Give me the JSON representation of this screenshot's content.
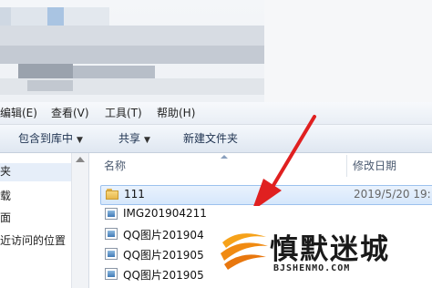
{
  "menubar": {
    "items": [
      "编辑(E)",
      "查看(V)",
      "工具(T)",
      "帮助(H)"
    ]
  },
  "toolbar": {
    "include_library": "包含到库中",
    "share": "共享",
    "new_folder": "新建文件夹"
  },
  "navpane": {
    "items": [
      "夹",
      "载",
      "面",
      "近访问的位置"
    ]
  },
  "columns": {
    "name": "名称",
    "date": "修改日期"
  },
  "files": [
    {
      "name": "111",
      "date": "2019/5/20 19:",
      "type": "folder",
      "selected": true
    },
    {
      "name": "IMG201904211",
      "date": "",
      "type": "image",
      "selected": false
    },
    {
      "name": "QQ图片201904",
      "date": "",
      "type": "image",
      "selected": false
    },
    {
      "name": "QQ图片201905",
      "date": "",
      "type": "image",
      "selected": false
    },
    {
      "name": "QQ图片201905",
      "date": "",
      "type": "image",
      "selected": false
    }
  ],
  "watermark": {
    "brand": "慎默迷城",
    "url": "BJSHENMO.COM"
  },
  "colors": {
    "arrow": "#e02020",
    "selection": "#d6e7fb",
    "folder": "#e7b84c"
  }
}
